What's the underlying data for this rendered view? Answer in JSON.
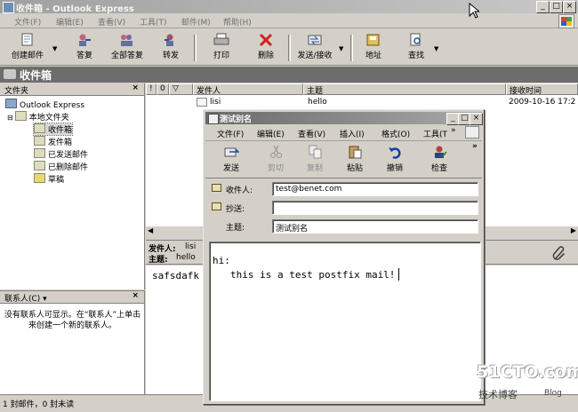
{
  "window": {
    "title": "收件箱 - Outlook Express",
    "min": "_",
    "max": "□",
    "close": "×"
  },
  "menu": [
    "文件(F)",
    "编辑(E)",
    "查看(V)",
    "工具(T)",
    "邮件(M)",
    "帮助(H)"
  ],
  "toolbar": [
    {
      "label": "创建邮件",
      "icon": "new-mail-icon"
    },
    {
      "label": "答复",
      "icon": "reply-icon"
    },
    {
      "label": "全部答复",
      "icon": "reply-all-icon"
    },
    {
      "label": "转发",
      "icon": "forward-icon"
    },
    {
      "label": "打印",
      "icon": "print-icon"
    },
    {
      "label": "删除",
      "icon": "delete-icon"
    },
    {
      "label": "发送/接收",
      "icon": "send-receive-icon"
    },
    {
      "label": "地址",
      "icon": "address-book-icon"
    },
    {
      "label": "查找",
      "icon": "find-icon"
    }
  ],
  "folder_band": {
    "title": "收件箱"
  },
  "folders_pane": {
    "header": "文件夹",
    "close": "×",
    "items": [
      "Outlook Express",
      "本地文件夹",
      "收件箱",
      "发件箱",
      "已发送邮件",
      "已删除邮件",
      "草稿"
    ]
  },
  "contacts_pane": {
    "header": "联系人(C) ▾",
    "close": "×",
    "empty_text": "没有联系人可显示。在“联系人”上单击来创建一个新的联系人。"
  },
  "message_list": {
    "columns": [
      "!",
      "0",
      "▽",
      "发件人",
      "主题",
      "接收时间"
    ],
    "rows": [
      {
        "from": "lisi",
        "subject": "hello",
        "received": "2009-10-16 17:2"
      }
    ]
  },
  "preview": {
    "from_label": "发件人:",
    "from_value": "lisi",
    "subject_label": "主题:",
    "subject_value": "hello",
    "body": "safsdafk"
  },
  "status": {
    "text": "1 封邮件，0 封未读"
  },
  "compose": {
    "title": "测试别名",
    "menu": [
      "文件(F)",
      "编辑(E)",
      "查看(V)",
      "插入(I)",
      "格式(O)",
      "工具(T"
    ],
    "overflow": "»",
    "toolbar": [
      {
        "label": "发送",
        "icon": "send-icon",
        "enabled": true
      },
      {
        "label": "剪切",
        "icon": "cut-icon",
        "enabled": false
      },
      {
        "label": "复制",
        "icon": "copy-icon",
        "enabled": false
      },
      {
        "label": "粘贴",
        "icon": "paste-icon",
        "enabled": true
      },
      {
        "label": "撤销",
        "icon": "undo-icon",
        "enabled": true
      },
      {
        "label": "检查",
        "icon": "check-names-icon",
        "enabled": true
      }
    ],
    "to_label": "收件人:",
    "to_value": "test@benet.com",
    "cc_label": "抄送:",
    "cc_value": "",
    "subject_label": "主题:",
    "subject_value": "测试别名",
    "body_line1": "hi:",
    "body_line2": "this is a test  postfix mail!"
  },
  "watermark": {
    "site": "51CTO.com",
    "tagline": "技术博客",
    "blog": "Blog"
  },
  "colors": {
    "title_gray": "#a0a0a0",
    "band": "#6d6d6d",
    "face": "#d4d0c8"
  }
}
